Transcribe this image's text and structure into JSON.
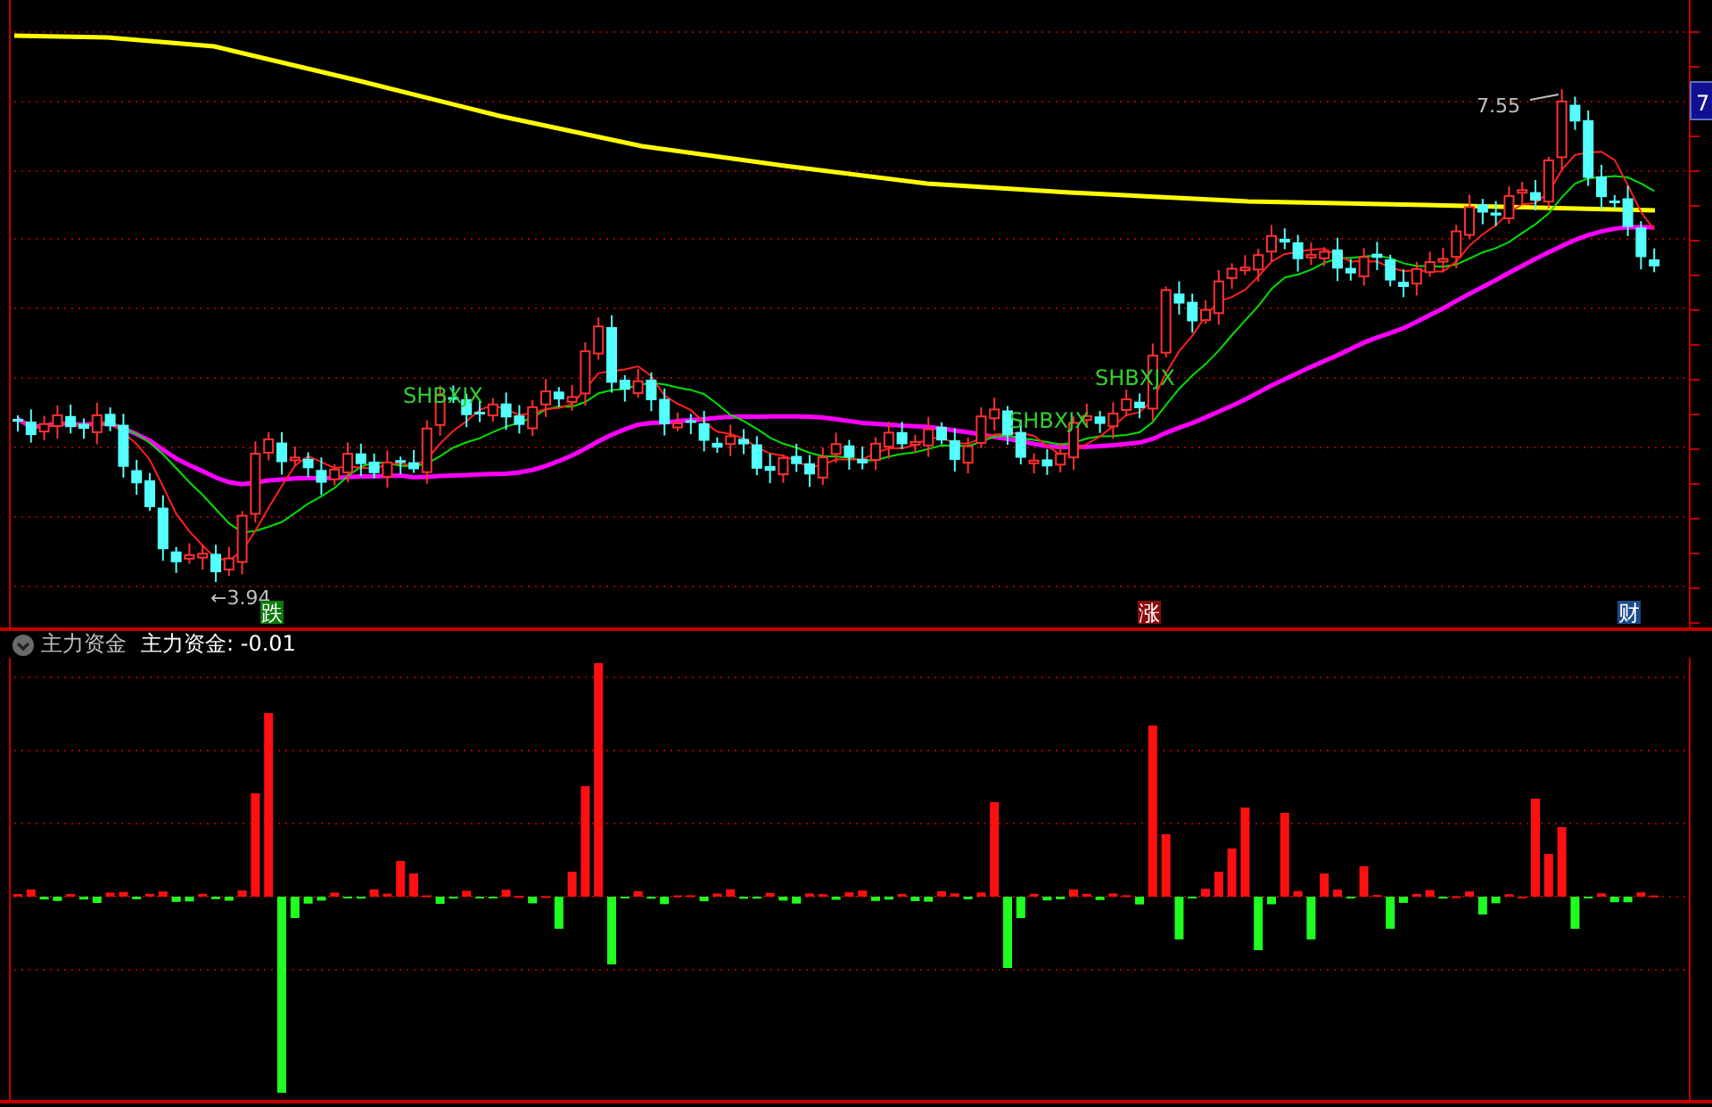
{
  "price_chart": {
    "axis_label": "7",
    "low_marker": "←3.94",
    "high_marker": "7.55",
    "signals": [
      {
        "label": "SHBXJX"
      },
      {
        "label": "SHBXJX"
      },
      {
        "label": "SHBXJX"
      }
    ],
    "badges": [
      {
        "kind": "down",
        "label": "跌"
      },
      {
        "kind": "up",
        "label": "涨"
      },
      {
        "kind": "finance",
        "label": "财"
      }
    ]
  },
  "indicator": {
    "name": "主力资金",
    "reading": "主力资金: -0.01"
  }
}
